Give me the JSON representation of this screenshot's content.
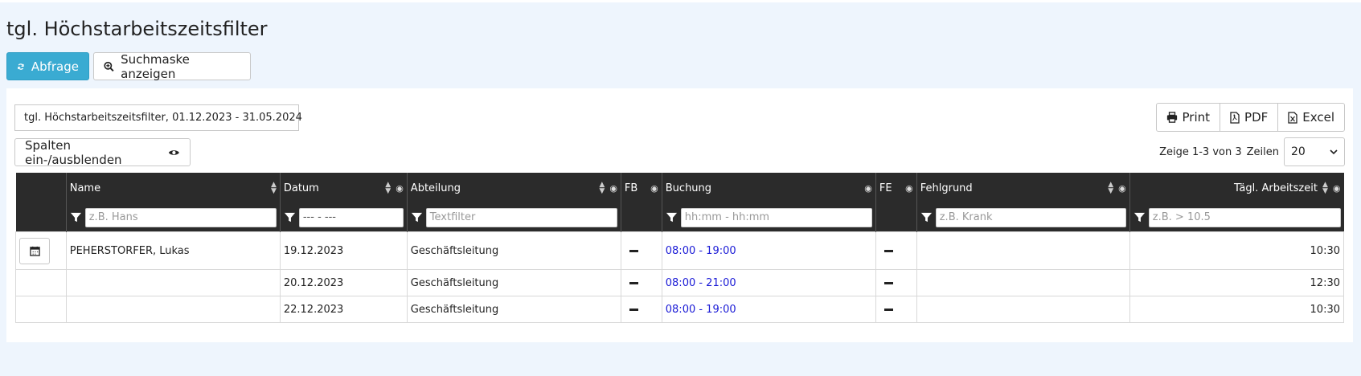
{
  "page": {
    "title": "tgl. Höchstarbeitszeitsfilter"
  },
  "toolbar": {
    "query_label": "Abfrage",
    "search_mask_label": "Suchmaske anzeigen"
  },
  "report": {
    "filter_info": "tgl. Höchstarbeitszeitsfilter, 01.12.2023 - 31.05.2024",
    "toggle_columns_label": "Spalten ein-/ausblenden",
    "export": {
      "print_label": "Print",
      "pdf_label": "PDF",
      "excel_label": "Excel"
    },
    "paging": {
      "info": "Zeige 1-3 von 3",
      "rows_label": "Zeilen",
      "rows_value": "20"
    }
  },
  "table": {
    "columns": {
      "name": {
        "label": "Name",
        "placeholder": "z.B. Hans"
      },
      "datum": {
        "label": "Datum",
        "placeholder": "--- - ---"
      },
      "abteilung": {
        "label": "Abteilung",
        "placeholder": "Textfilter"
      },
      "fb": {
        "label": "FB"
      },
      "buchung": {
        "label": "Buchung",
        "placeholder": "hh:mm - hh:mm"
      },
      "fe": {
        "label": "FE"
      },
      "fehlgrund": {
        "label": "Fehlgrund",
        "placeholder": "z.B. Krank"
      },
      "arbeitszeit": {
        "label": "Tägl. Arbeitszeit",
        "placeholder": "z.B. > 10.5"
      }
    },
    "rows": [
      {
        "name": "PEHERSTORFER, Lukas",
        "datum": "19.12.2023",
        "abteilung": "Geschäftsleitung",
        "buchung": "08:00 - 19:00",
        "fehlgrund": "",
        "arbeitszeit": "10:30"
      },
      {
        "name": "",
        "datum": "20.12.2023",
        "abteilung": "Geschäftsleitung",
        "buchung": "08:00 - 21:00",
        "fehlgrund": "",
        "arbeitszeit": "12:30"
      },
      {
        "name": "",
        "datum": "22.12.2023",
        "abteilung": "Geschäftsleitung",
        "buchung": "08:00 - 19:00",
        "fehlgrund": "",
        "arbeitszeit": "10:30"
      }
    ]
  },
  "colors": {
    "primary": "#3aabd2",
    "header_bg": "#2b2b2b",
    "link": "#1a1ad6",
    "page_bg": "#eef5fd"
  },
  "icons": [
    "refresh-icon",
    "search-plus-icon",
    "eye-icon",
    "print-icon",
    "pdf-icon",
    "excel-icon",
    "calendar-icon",
    "filter-icon",
    "sort-icon",
    "chevron-down-icon"
  ]
}
